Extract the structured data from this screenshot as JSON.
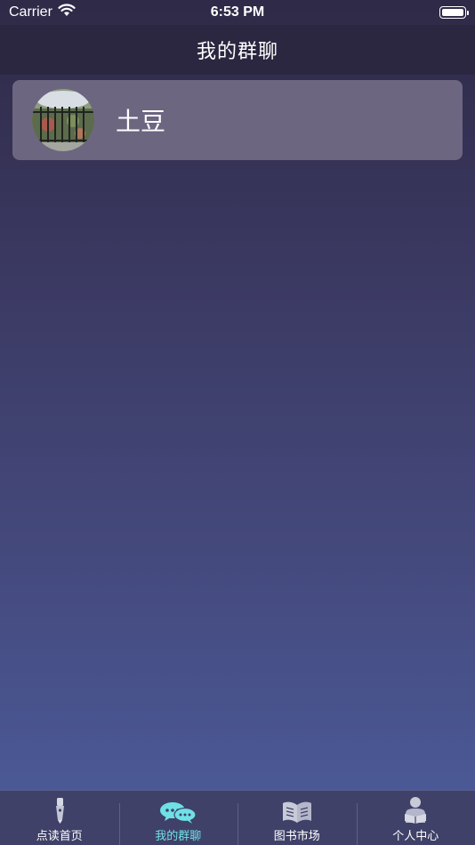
{
  "status_bar": {
    "carrier": "Carrier",
    "time": "6:53 PM"
  },
  "nav": {
    "title": "我的群聊"
  },
  "groups": [
    {
      "name": "土豆",
      "avatar_icon": "group-avatar-photo"
    }
  ],
  "tab_bar": {
    "active_color": "#6fe0e6",
    "tabs": [
      {
        "label": "点读首页",
        "icon": "pen-icon",
        "active": false
      },
      {
        "label": "我的群聊",
        "icon": "chat-bubbles-icon",
        "active": true
      },
      {
        "label": "图书市场",
        "icon": "book-icon",
        "active": false
      },
      {
        "label": "个人中心",
        "icon": "person-reading-icon",
        "active": false
      }
    ]
  }
}
